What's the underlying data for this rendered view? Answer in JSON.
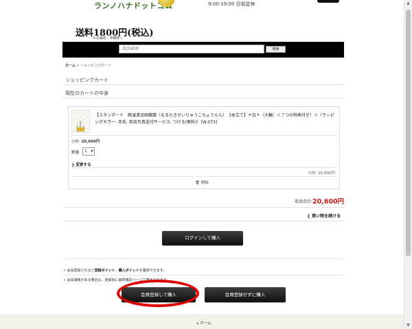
{
  "header": {
    "logo_text": "ランノハナドットコム",
    "hours": "9:00-19:00 日祝定休"
  },
  "shipping": {
    "title": "送料1800円(税込)",
    "note": "※北海道・沖縄除く"
  },
  "search": {
    "placeholder": "商品検索",
    "button_label": "検索"
  },
  "breadcrumb": {
    "home": "ホーム",
    "separator": " > ",
    "current": "ショッピングカート"
  },
  "page_title": "ショッピングカート",
  "cart_heading": "現在のカートの中身",
  "cart_item": {
    "name": "【スタンダード　暁滝清流胡蝶蘭（なるたきせいりゅうこちょうらん）　3本立て】＊白＊（大輪）＜７つの特典付き！＞（ラッピングカラー: 赤系, 商品写真送付サービス: つける(無料)）[W-ST3]",
    "subtotal_label": "小計:",
    "subtotal_value": "20,600円",
    "quantity_label": "数量:",
    "quantity_value": "1",
    "change_label": "変更する",
    "subtotal_right": "小計: 20,600円",
    "delete_label": "削除"
  },
  "totals": {
    "label": "商品合計:",
    "value": "20,600円"
  },
  "continue_label": "買い物を続ける",
  "login_button": "ログインして購入",
  "notes": {
    "line1_prefix": "会員登録されると",
    "line1_bold1": "登録ポイント",
    "line1_mid": "、",
    "line1_bold2": "購入ポイント",
    "line1_suffix": "を獲得できます。",
    "line2": "会員価格がある場合は、登録後に最終確認ページで表示されます。"
  },
  "register_button": "会員登録して購入",
  "guest_button": "会員登録せずに購入",
  "footer": {
    "home_label": "ホーム"
  },
  "colors": {
    "accent_red": "#c61e1e",
    "highlight_oval": "#e00000",
    "search_bar": "#000000"
  }
}
